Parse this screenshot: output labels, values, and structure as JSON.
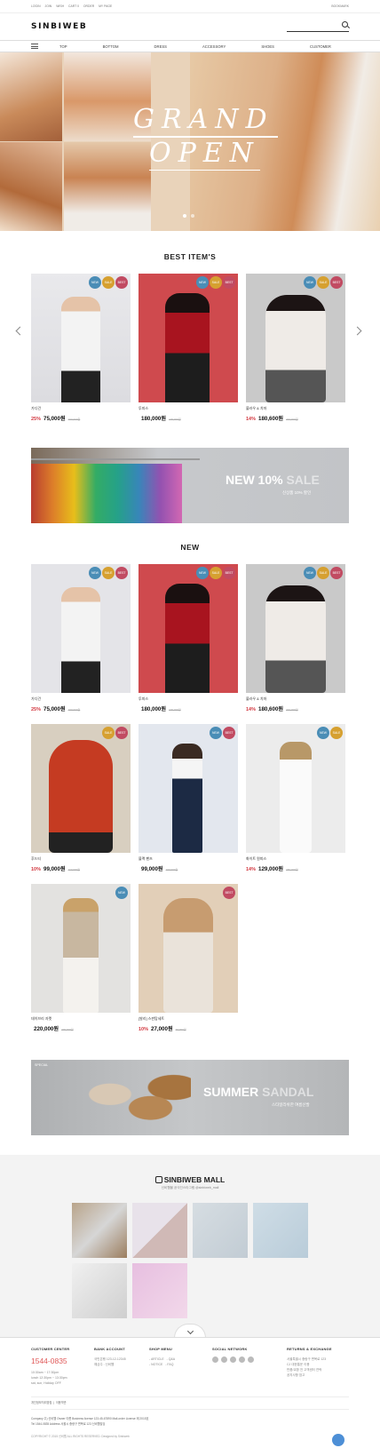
{
  "topbar": {
    "links": [
      "LOGIN",
      "JOIN",
      "WISH",
      "CART 0",
      "ORDER",
      "MY PAGE"
    ],
    "right": "BOOKMARK"
  },
  "header": {
    "logo": "SINBIWEB"
  },
  "nav": {
    "items": [
      "TOP",
      "BOTTOM",
      "DRESS",
      "ACCESSORY",
      "SHOES",
      "CUSTOMER"
    ]
  },
  "hero": {
    "line1": "GRAND",
    "line2": "OPEN"
  },
  "best": {
    "title": "BEST ITEM'S",
    "products": [
      {
        "name": "가디건",
        "discount": "25%",
        "price": "75,000원",
        "old": "100,000원",
        "badges": [
          "NEW",
          "SALE",
          "BEST"
        ]
      },
      {
        "name": "투피스",
        "discount": "",
        "price": "180,000원",
        "old": "100,000원",
        "badges": [
          "NEW",
          "SALE",
          "BEST"
        ]
      },
      {
        "name": "블라우 & 치마",
        "discount": "14%",
        "price": "180,600원",
        "old": "210,000원",
        "badges": [
          "NEW",
          "SALE",
          "BEST"
        ]
      }
    ]
  },
  "banner1": {
    "big": "NEW 10%",
    "big_fade": "SALE",
    "small": "신상품 10% 할인"
  },
  "new_section": {
    "title": "NEW",
    "products": [
      {
        "name": "가디건",
        "discount": "25%",
        "price": "75,000원",
        "old": "100,000원",
        "badges": [
          "NEW",
          "SALE",
          "BEST"
        ]
      },
      {
        "name": "투피스",
        "discount": "",
        "price": "180,000원",
        "old": "100,000원",
        "badges": [
          "NEW",
          "SALE",
          "BEST"
        ]
      },
      {
        "name": "블라우 & 치마",
        "discount": "14%",
        "price": "180,600원",
        "old": "210,000원",
        "badges": [
          "NEW",
          "SALE",
          "BEST"
        ]
      },
      {
        "name": "후드티",
        "discount": "10%",
        "price": "99,000원",
        "old": "110,000원",
        "badges": [
          "SALE",
          "BEST"
        ]
      },
      {
        "name": "블랙 팬츠",
        "discount": "",
        "price": "99,000원",
        "old": "100,000원",
        "badges": [
          "NEW",
          "BEST"
        ]
      },
      {
        "name": "화이트 원피스",
        "discount": "14%",
        "price": "129,000원",
        "old": "150,000원",
        "badges": [
          "NEW",
          "SALE"
        ]
      },
      {
        "name": "데이브리 자켓",
        "discount": "",
        "price": "220,000원",
        "old": "230,000원",
        "badges": [
          "NEW"
        ]
      },
      {
        "name": "[발리] 스판탑세트",
        "discount": "10%",
        "price": "27,000원",
        "old": "30,000원",
        "badges": [
          "BEST"
        ]
      }
    ]
  },
  "banner2": {
    "tag": "SPECIAL",
    "big": "SUMMER",
    "big_fade": "SANDAL",
    "small": "스타일리쉬한 여름신발"
  },
  "mall": {
    "title": "SINBIWEB MALL",
    "sub": "신비웹몰 공식인스타그램 @sinbiweb_mall"
  },
  "footer": {
    "cs": {
      "title": "CUSTOMER CENTER",
      "phone": "1544-0835",
      "lines": [
        "10:30am ~ 17:30pm",
        "lunch 12:30pm ~ 13:30pm",
        "sat, sun, Holiday OFF"
      ]
    },
    "bank": {
      "title": "BANK ACCOUNT",
      "lines": [
        "국민은행 123-12-12345",
        "예금주 : 신비웹"
      ]
    },
    "shop": {
      "title": "SHOP MENU",
      "lines": [
        "- ARTICLE",
        "- NOTICE",
        "- Q&A",
        "- FAQ"
      ]
    },
    "social": {
      "title": "SOCIAL NETWORK"
    },
    "returns": {
      "title": "RETURNS & EXCHANGE",
      "lines": [
        "서울특별시 중랑구 면목로 123",
        "CJ 대한통운 이용",
        "반품/교환 전 고객센터 연락",
        "공지사항 참고"
      ]
    },
    "bottom_links": [
      "개인정보처리방침",
      "이용약관"
    ],
    "company": "Company 주) 신비웹   Owner 이름   Business license 123-45-67890   Mail-order License 제 2015호",
    "address": "Tel 1544-0835   Address 서울시 중랑구 면목로 123 신비웹빌딩",
    "copyright": "COPYRIGHT © 2015 신비웹 ALL RIGHTS RESERVED. Designed by Sinbiweb"
  }
}
